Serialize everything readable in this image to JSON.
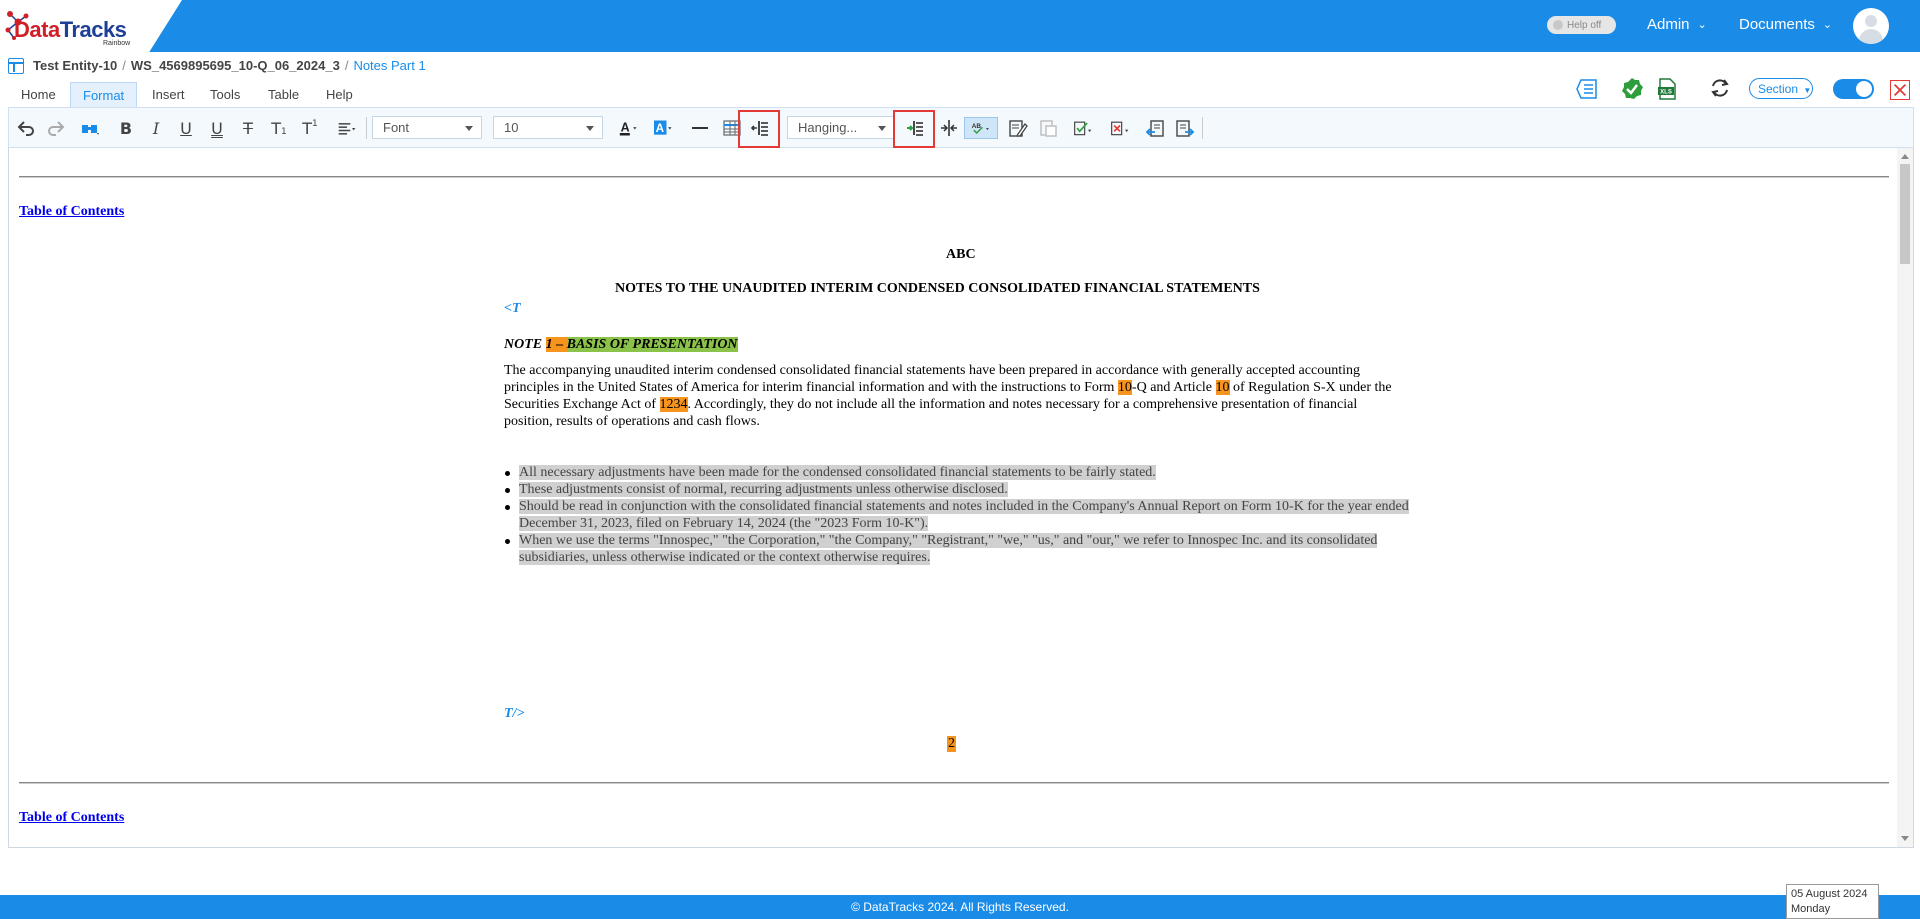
{
  "header": {
    "logo_brand_a": "Data",
    "logo_brand_b": "Tracks",
    "logo_sub": "Rainbow",
    "help_toggle_label": "Help off",
    "admin_label": "Admin",
    "documents_label": "Documents"
  },
  "breadcrumb": {
    "entity": "Test Entity-10",
    "workspace": "WS_4569895695_10-Q_06_2024_3",
    "separator": "/",
    "current": "Notes Part 1"
  },
  "menu": {
    "tabs": [
      {
        "label": "Home"
      },
      {
        "label": "Format"
      },
      {
        "label": "Insert"
      },
      {
        "label": "Tools"
      },
      {
        "label": "Table"
      },
      {
        "label": "Help"
      }
    ],
    "active_tab": "Format"
  },
  "right_tools": {
    "section_label": "Section"
  },
  "toolbar": {
    "font_label": "Font",
    "size_label": "10",
    "indent_label": "Hanging...",
    "icons": [
      "undo-icon",
      "redo-icon",
      "find-replace-icon",
      "bold-icon",
      "italic-icon",
      "underline-icon",
      "double-underline-icon",
      "strikethrough-icon",
      "subscript-icon",
      "superscript-icon",
      "align-icon",
      "font-color-icon",
      "highlight-color-icon",
      "horizontal-line-icon",
      "table-icon",
      "decrease-indent-icon",
      "increase-indent-icon",
      "column-split-icon",
      "spellcheck-icon",
      "edit-note-icon",
      "paste-icon",
      "approve-icon",
      "reject-icon",
      "export-left-icon",
      "export-right-icon"
    ]
  },
  "document": {
    "toc_link": "Table of Contents",
    "company": "ABC",
    "heading": "NOTES TO THE UNAUDITED INTERIM CONDENSED CONSOLIDATED FINANCIAL STATEMENTS",
    "tag_open": "<T",
    "tag_close": "T/>",
    "note_prefix": "NOTE ",
    "note_number": "1",
    "note_dash": " – ",
    "note_title": "BASIS OF PRESENTATION",
    "para_1": "The accompanying unaudited interim condensed consolidated financial statements have been prepared in accordance with generally accepted accounting principles in the United States of America for interim financial information and with the instructions to Form ",
    "para_form_num": "10",
    "para_2": "-Q and Article ",
    "para_article_num": "10",
    "para_3": " of Regulation S-X under the Securities Exchange Act of ",
    "para_year": "1234",
    "para_4": ". Accordingly, they do not include all the information and notes necessary for a comprehensive presentation of financial position, results of operations and cash flows.",
    "bullets": [
      "All necessary adjustments have been made for the condensed consolidated financial statements to be fairly stated.",
      "These adjustments consist of normal, recurring adjustments unless otherwise disclosed.",
      "Should be read in conjunction with the consolidated financial statements and notes included in the Company's Annual Report on Form 10-K for the year ended December 31, 2023, filed on February 14, 2024 (the \"2023 Form 10-K\").",
      "When we use the terms \"Innospec,\" \"the Corporation,\" \"the Company,\" \"Registrant,\" \"we,\" \"us,\" and \"our,\" we refer to Innospec Inc. and its consolidated subsidiaries, unless otherwise indicated or the context otherwise requires."
    ],
    "page_number": "2"
  },
  "footer": {
    "copyright": "© DataTracks 2024. All Rights Reserved.",
    "date": "05 August 2024",
    "weekday": "Monday"
  },
  "colors": {
    "brand_blue": "#1a8ce8",
    "highlight_orange": "#f7941d",
    "highlight_green": "#8bc34a",
    "annotation_red": "#e53935"
  }
}
